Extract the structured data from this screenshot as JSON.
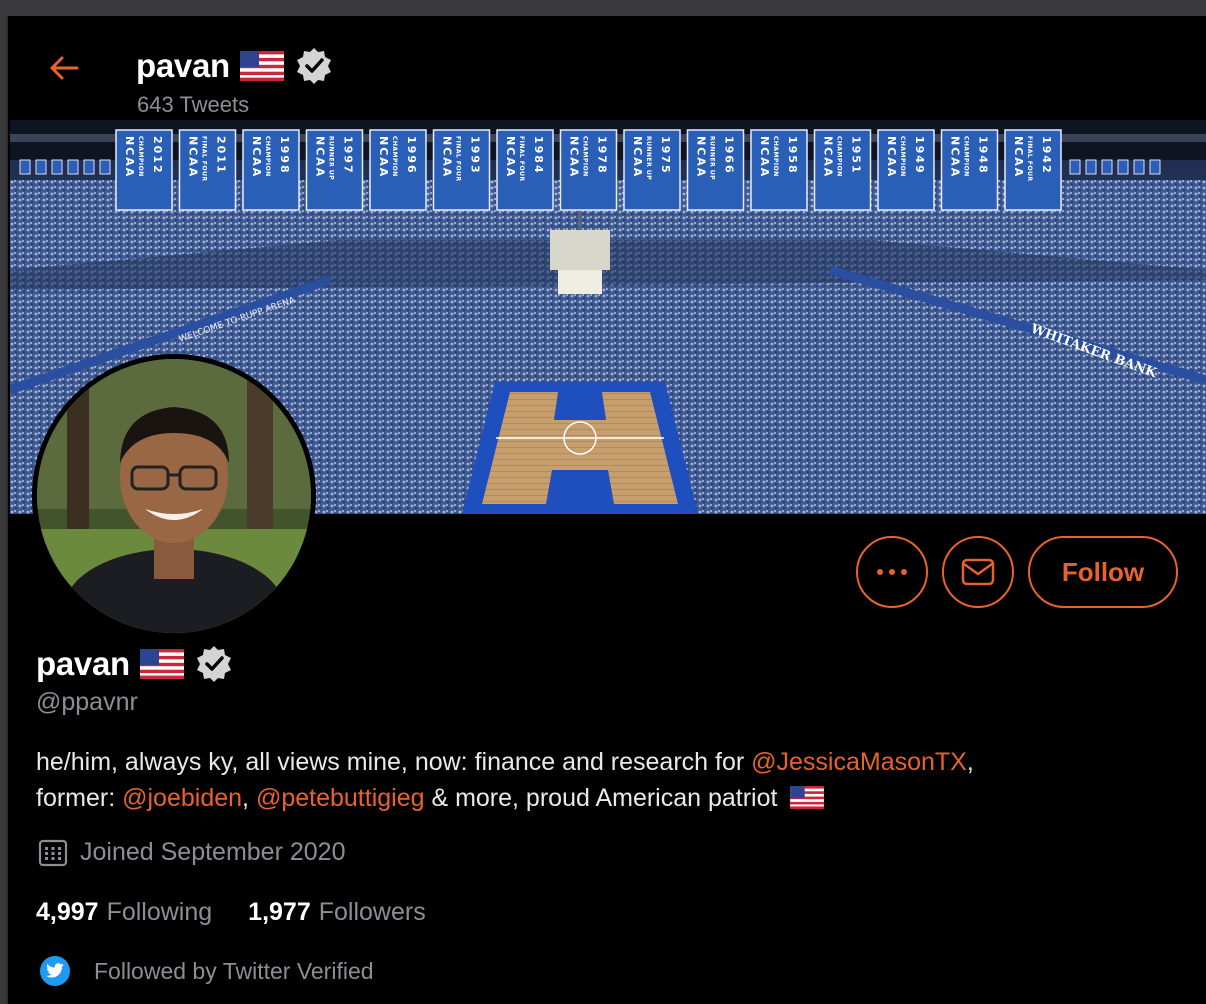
{
  "header": {
    "name": "pavan",
    "tweet_count": "643 Tweets"
  },
  "profile": {
    "display_name": "pavan",
    "handle": "@ppavnr",
    "bio": {
      "part1": "he/him, always ky, all views mine, now: finance and research for ",
      "mention1": "@JessicaMasonTX",
      "part2": ",",
      "part3": "former: ",
      "mention2": "@joebiden",
      "part4": ", ",
      "mention3": "@petebuttigieg",
      "part5": " & more, proud American patriot"
    },
    "joined": "Joined September 2020",
    "following_count": "4,997",
    "following_label": "Following",
    "followers_count": "1,977",
    "followers_label": "Followers",
    "followed_by": "Followed by Twitter Verified"
  },
  "actions": {
    "follow_label": "Follow"
  },
  "banner": {
    "banners": [
      {
        "top": "NCAA",
        "mid": "CHAMPION",
        "year": "2012"
      },
      {
        "top": "NCAA",
        "mid": "FINAL FOUR",
        "year": "2011"
      },
      {
        "top": "NCAA",
        "mid": "CHAMPION",
        "year": "1998"
      },
      {
        "top": "NCAA",
        "mid": "RUNNER UP",
        "year": "1997"
      },
      {
        "top": "NCAA",
        "mid": "CHAMPION",
        "year": "1996"
      },
      {
        "top": "NCAA",
        "mid": "FINAL FOUR",
        "year": "1993"
      },
      {
        "top": "NCAA",
        "mid": "FINAL FOUR",
        "year": "1984"
      },
      {
        "top": "NCAA",
        "mid": "CHAMPION",
        "year": "1978"
      },
      {
        "top": "NCAA",
        "mid": "RUNNER UP",
        "year": "1975"
      },
      {
        "top": "NCAA",
        "mid": "RUNNER UP",
        "year": "1966"
      },
      {
        "top": "NCAA",
        "mid": "CHAMPION",
        "year": "1958"
      },
      {
        "top": "NCAA",
        "mid": "CHAMPION",
        "year": "1951"
      },
      {
        "top": "NCAA",
        "mid": "CHAMPION",
        "year": "1949"
      },
      {
        "top": "NCAA",
        "mid": "CHAMPION",
        "year": "1948"
      },
      {
        "top": "NCAA",
        "mid": "FINAL FOUR",
        "year": "1942"
      }
    ],
    "sign_left": "WELCOME TO RUPP ARENA",
    "sign_right": "WHITAKER BANK"
  },
  "icons": {
    "back": "arrow-left-icon",
    "verified": "verified-badge-icon",
    "flag": "us-flag-icon",
    "more": "more-dots-icon",
    "message": "envelope-icon",
    "calendar": "calendar-icon",
    "twitter": "twitter-bird-icon"
  },
  "colors": {
    "accent": "#e8632b",
    "muted": "#8b8f94",
    "background": "#000000",
    "twitter_blue": "#1d9bf0",
    "banner_blue": "#2a5fb8"
  }
}
